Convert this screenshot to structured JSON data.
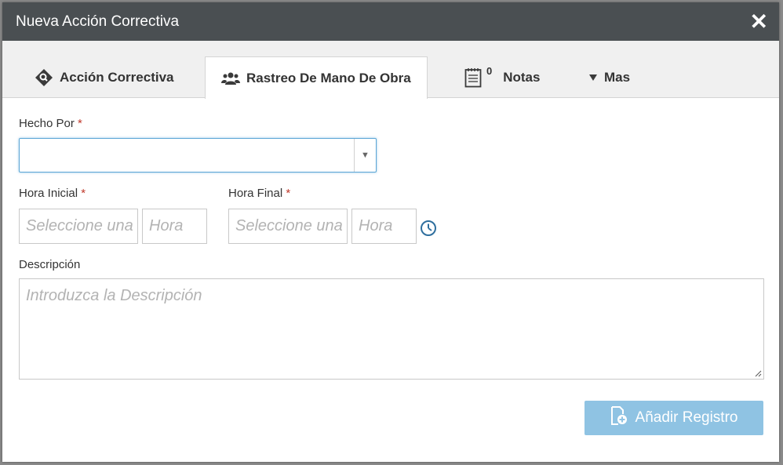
{
  "dialog": {
    "title": "Nueva Acción Correctiva",
    "close_symbol": "✕"
  },
  "tabs": [
    {
      "label": "Acción Correctiva",
      "icon": "diamond-search-icon",
      "active": false
    },
    {
      "label": "Rastreo De Mano De Obra",
      "icon": "users-icon",
      "active": true
    },
    {
      "label": "Notas",
      "icon": "notepad-icon",
      "count": "0",
      "active": false
    },
    {
      "label": "Mas",
      "icon": "caret-down-icon",
      "active": false
    }
  ],
  "form": {
    "hecho_por": {
      "label": "Hecho Por",
      "required_mark": "*",
      "value": ""
    },
    "hora_inicial": {
      "label": "Hora Inicial",
      "required_mark": "*",
      "date_placeholder": "Seleccione una fecha",
      "time_placeholder": "Hora"
    },
    "hora_final": {
      "label": "Hora Final",
      "required_mark": "*",
      "date_placeholder": "Seleccione una fecha",
      "time_placeholder": "Hora"
    },
    "descripcion": {
      "label": "Descripción",
      "placeholder": "Introduzca la Descripción"
    }
  },
  "actions": {
    "add_label": "Añadir Registro"
  },
  "colors": {
    "titlebar": "#4a4f52",
    "accent": "#5ba6d6",
    "button": "#8fc3e3",
    "required": "#c0392b"
  }
}
